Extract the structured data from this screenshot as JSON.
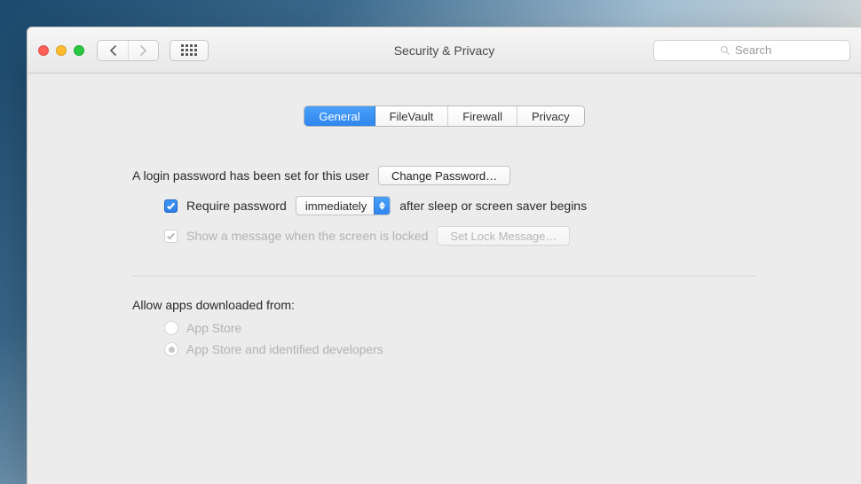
{
  "window": {
    "title": "Security & Privacy"
  },
  "search": {
    "placeholder": "Search"
  },
  "tabs": {
    "general": "General",
    "filevault": "FileVault",
    "firewall": "Firewall",
    "privacy": "Privacy"
  },
  "general": {
    "password_set_text": "A login password has been set for this user",
    "change_password_btn": "Change Password…",
    "require_password_label": "Require password",
    "require_password_delay": "immediately",
    "after_sleep_text": "after sleep or screen saver begins",
    "show_message_label": "Show a message when the screen is locked",
    "set_lock_message_btn": "Set Lock Message…",
    "allow_apps_title": "Allow apps downloaded from:",
    "radio_app_store": "App Store",
    "radio_identified": "App Store and identified developers"
  }
}
